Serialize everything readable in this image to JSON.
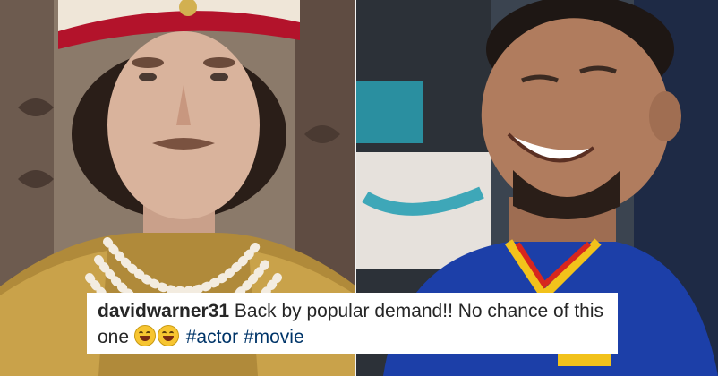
{
  "images": {
    "left": {
      "subject": "man-in-royal-costume-photo"
    },
    "right": {
      "subject": "man-laughing-photo"
    }
  },
  "caption": {
    "username": "davidwarner31",
    "text": "Back by popular demand!! No chance of this one",
    "emojis": [
      "face-with-tears-of-joy-icon",
      "face-with-tears-of-joy-icon"
    ],
    "hashtags": [
      "#actor",
      "#movie"
    ]
  },
  "colors": {
    "caption_background": "#ffffff",
    "caption_text": "#262626",
    "hashtag": "#003569",
    "jersey_blue": "#1c3fa8",
    "turban_red": "#b3132b"
  }
}
